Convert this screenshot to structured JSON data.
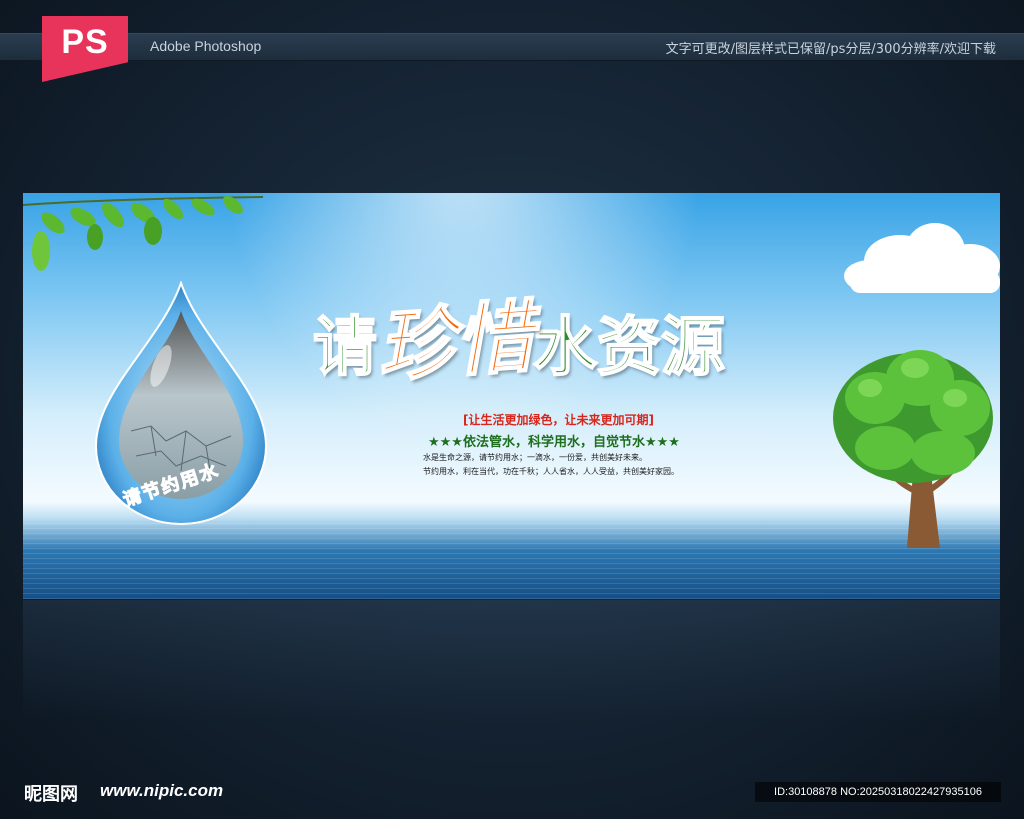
{
  "header": {
    "ps_logo": "PS",
    "app_name": "Adobe Photoshop",
    "features": "文字可更改/图层样式已保留/ps分层/300分辨率/欢迎下载"
  },
  "banner": {
    "headline": {
      "part1": "请",
      "part2": "珍惜",
      "part3": "水资源"
    },
    "drop_caption": "请节约用水",
    "slogan1": "[让生活更加绿色，让未来更加可期]",
    "slogan2": "★★★依法管水，科学用水，自觉节水★★★",
    "body1": "水是生命之源，请节约用水；一滴水，一份爱，共创美好未来。",
    "body2": "节约用水，利在当代，功在千秋；人人省水，人人受益，共创美好家园。"
  },
  "footer": {
    "site_logo": "昵图网",
    "site_url": "www.nipic.com",
    "image_id": "ID:30108878 NO:20250318022427935106"
  },
  "colors": {
    "accent_pink": "#e8345a",
    "headline_green": "#2f8a2a",
    "headline_orange": "#ef6a10",
    "slogan_red": "#d8261c"
  }
}
